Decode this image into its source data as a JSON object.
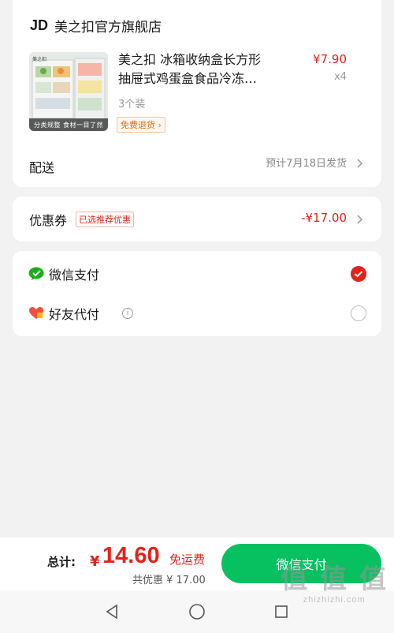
{
  "store": {
    "logo": "JD",
    "name": "美之扣官方旗舰店"
  },
  "product": {
    "title_line1": "美之扣 冰箱收纳盒长方形",
    "title_line2": "抽屉式鸡蛋盒食品冷冻…",
    "spec": "3个装",
    "return_badge": "免费退货",
    "return_chevron": "›",
    "price": "¥7.90",
    "quantity": "x4",
    "thumb_brand": "美之扣",
    "thumb_caption": "分类规整 食材一目了然"
  },
  "delivery": {
    "label": "配送",
    "info": "预计7月18日发货"
  },
  "coupon": {
    "label": "优惠券",
    "tag": "已选推荐优惠",
    "amount": "-¥17.00"
  },
  "payment": {
    "options": [
      {
        "label": "微信支付",
        "icon": "wechat-pay-icon",
        "selected": true
      },
      {
        "label": "好友代付",
        "icon": "friend-pay-heart-icon",
        "selected": false
      }
    ]
  },
  "summary": {
    "total_label": "总计:",
    "currency": "¥",
    "total_value": "14.60",
    "free_shipping": "免运费",
    "discount_note": "共优惠 ¥ 17.00",
    "pay_button": "微信支付"
  },
  "watermark": {
    "glyphs": "值 值 值",
    "url": "zhizhizhi.com"
  },
  "colors": {
    "accent_red": "#e2231a",
    "wechat_green": "#07c160",
    "badge_orange": "#e36a13"
  }
}
